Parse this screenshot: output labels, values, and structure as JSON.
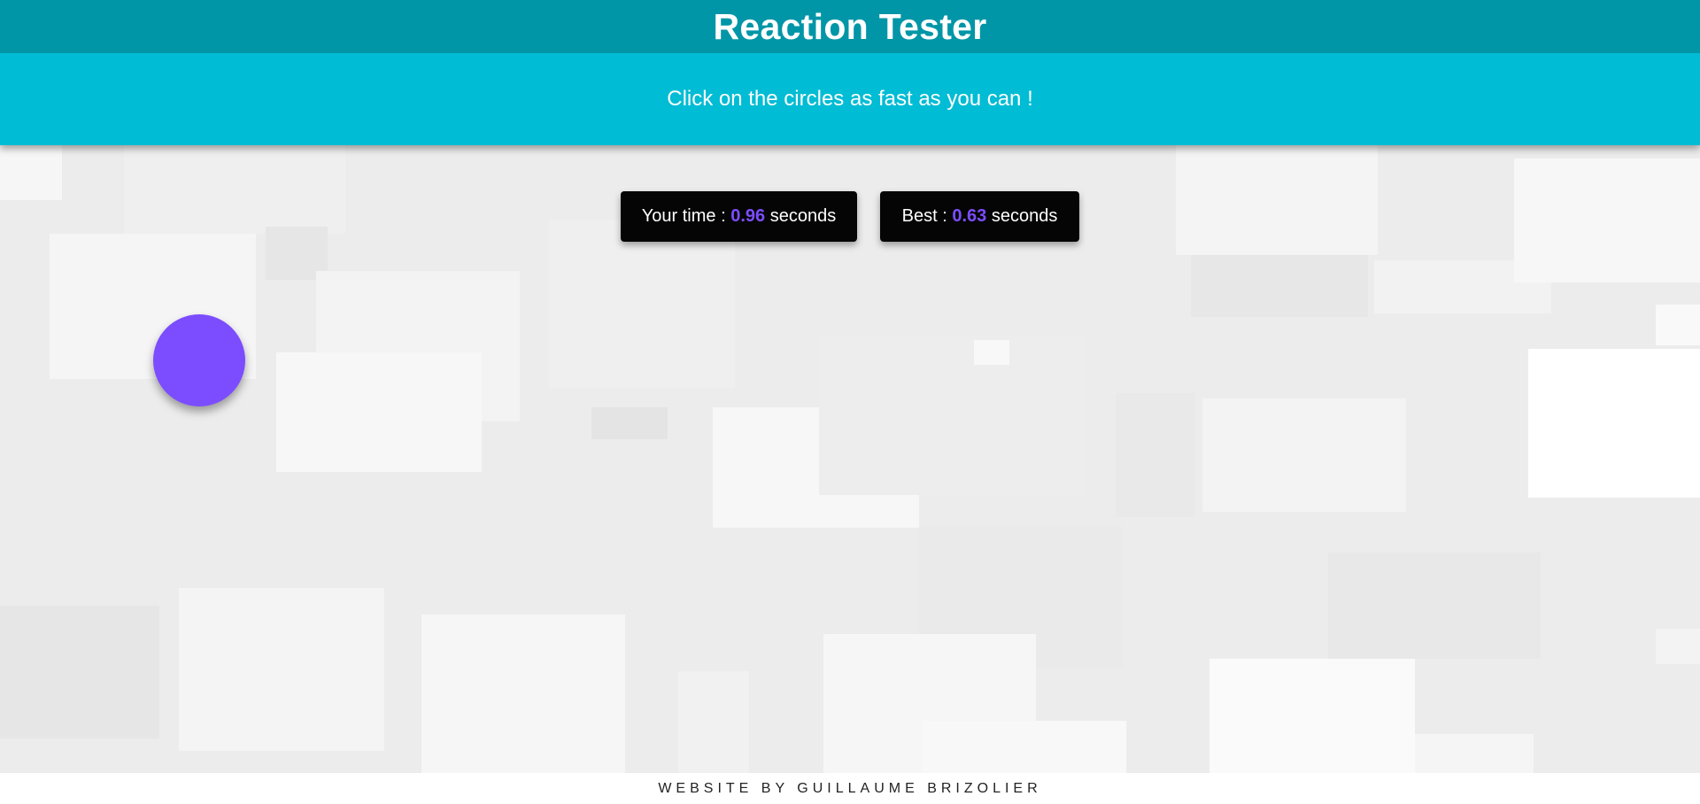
{
  "header": {
    "title": "Reaction Tester",
    "subtitle": "Click on the circles as fast as you can !"
  },
  "scores": {
    "your_time_label": "Your time :",
    "your_time_value": "0.96",
    "your_time_unit": "seconds",
    "best_label": "Best :",
    "best_value": "0.63",
    "best_unit": "seconds"
  },
  "footer": {
    "credit": "WEBSITE BY GUILLAUME BRIZOLIER"
  },
  "colors": {
    "title_bar": "#0096a7",
    "subtitle_bar": "#00bcd4",
    "accent": "#7c4dff",
    "circle": "#7c4dff",
    "score_box": "#050505",
    "background": "#ececec"
  }
}
